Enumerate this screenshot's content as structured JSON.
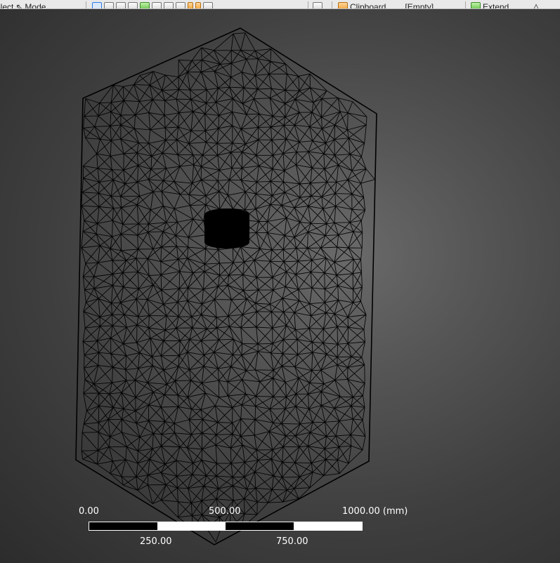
{
  "toolbar": {
    "select_label": "Select",
    "mode_label": "Mode",
    "clipboard_label": "Clipboard",
    "clipboard_value": "[Empty]",
    "extend_label": "Extend"
  },
  "scale": {
    "labels_top": [
      "0.00",
      "500.00",
      "1000.00 (mm)"
    ],
    "labels_bottom": [
      "250.00",
      "750.00"
    ]
  },
  "colors": {
    "mesh_edge": "#000000",
    "background_center": "#6a6a6a",
    "background_edge": "#2c2c2c"
  }
}
